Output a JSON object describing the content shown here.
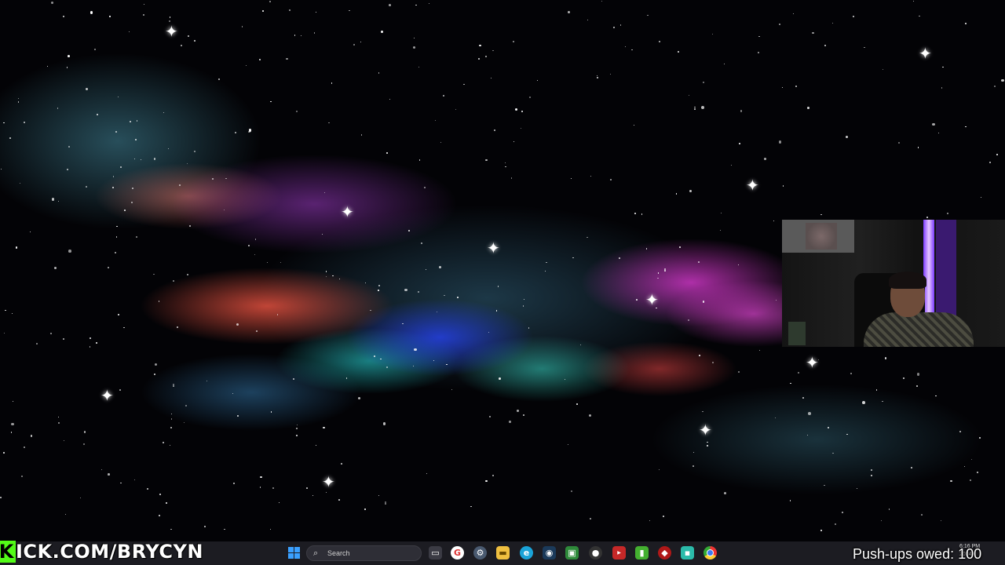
{
  "overlay": {
    "kick_letter": "K",
    "kick_text": "ICK.COM/BRYCYN",
    "pushups": "Push-ups owed: 100"
  },
  "taskbar": {
    "search_placeholder": "Search",
    "clock_time": "6:16 PM",
    "clock_date": "2024",
    "icons": [
      "windows-start-icon",
      "search-icon",
      "task-view-icon",
      "google-app-icon",
      "settings-icon",
      "file-explorer-icon",
      "edge-browser-icon",
      "steam-icon",
      "android-app-icon",
      "github-icon",
      "video-editor-icon",
      "green-app-icon",
      "red-app-icon",
      "teal-app-icon",
      "chrome-icon"
    ]
  }
}
